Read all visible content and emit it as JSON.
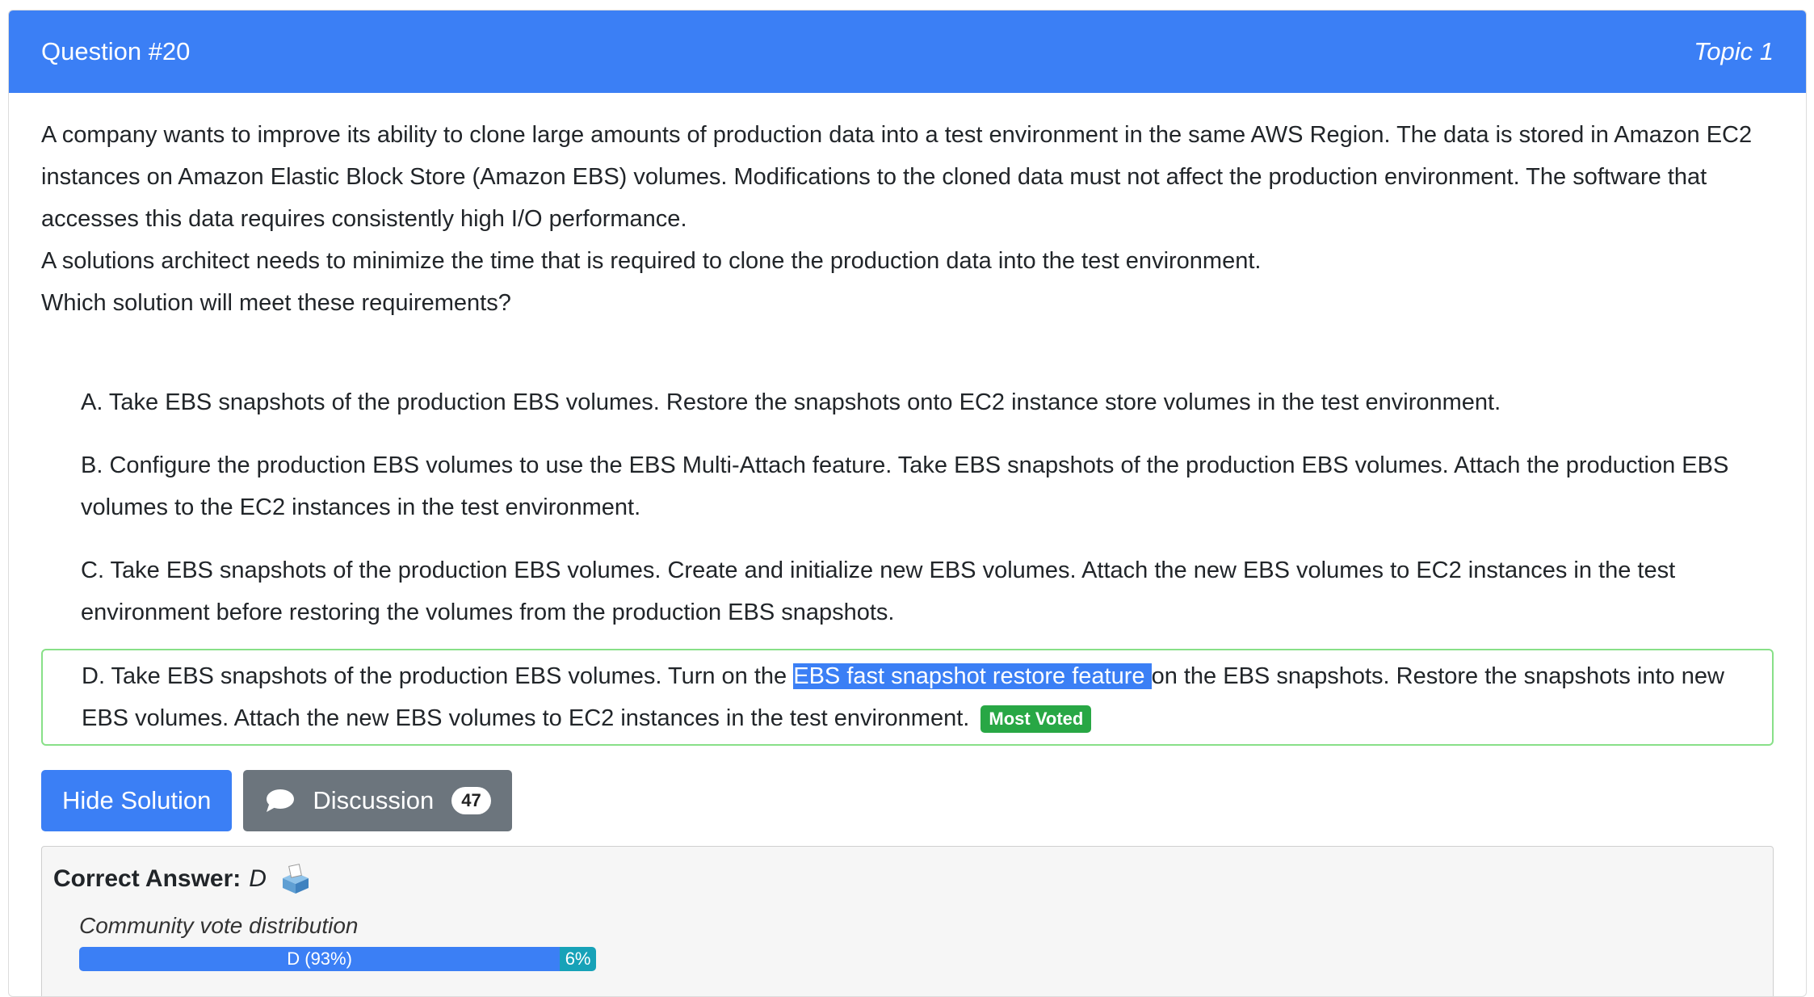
{
  "header": {
    "question_label": "Question #20",
    "topic_label": "Topic 1"
  },
  "question": {
    "paragraphs": [
      "A company wants to improve its ability to clone large amounts of production data into a test environment in the same AWS Region. The data is stored in Amazon EC2 instances on Amazon Elastic Block Store (Amazon EBS) volumes. Modifications to the cloned data must not affect the production environment. The software that accesses this data requires consistently high I/O performance.",
      "A solutions architect needs to minimize the time that is required to clone the production data into the test environment.",
      "Which solution will meet these requirements?"
    ]
  },
  "choices": [
    {
      "text": "A. Take EBS snapshots of the production EBS volumes. Restore the snapshots onto EC2 instance store volumes in the test environment."
    },
    {
      "text": "B. Configure the production EBS volumes to use the EBS Multi-Attach feature. Take EBS snapshots of the production EBS volumes. Attach the production EBS volumes to the EC2 instances in the test environment."
    },
    {
      "text": "C. Take EBS snapshots of the production EBS volumes. Create and initialize new EBS volumes. Attach the new EBS volumes to EC2 instances in the test environment before restoring the volumes from the production EBS snapshots."
    },
    {
      "text_before": "D. Take EBS snapshots of the production EBS volumes. Turn on the ",
      "highlighted": "EBS fast snapshot restore feature ",
      "text_after": "on the EBS snapshots. Restore the snapshots into new EBS volumes. Attach the new EBS volumes to EC2 instances in the test environment.",
      "badge": "Most Voted"
    }
  ],
  "buttons": {
    "hide_solution": "Hide Solution",
    "discussion": "Discussion",
    "discussion_count": "47"
  },
  "answer": {
    "label": "Correct Answer:",
    "letter": "D",
    "vote_label": "Community vote distribution",
    "votes": [
      {
        "label": "D (93%)",
        "percent": 93,
        "color": "#3b7ff5"
      },
      {
        "label": "6%",
        "percent": 7,
        "color": "#17a2b8"
      }
    ]
  },
  "colors": {
    "primary": "#3b7ff5",
    "secondary": "#6c757d",
    "success": "#28a745",
    "correct_border": "#88e088"
  },
  "icons": [
    "chat-bubble-icon",
    "ballot-box-icon"
  ]
}
